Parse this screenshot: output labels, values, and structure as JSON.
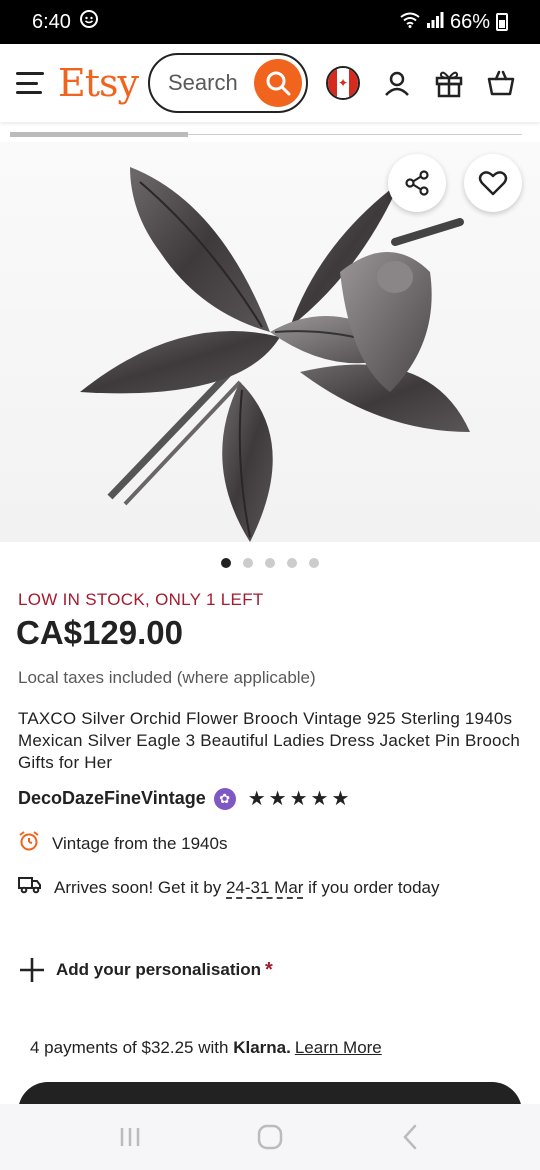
{
  "status_bar": {
    "time": "6:40",
    "battery": "66%"
  },
  "header": {
    "logo": "Etsy",
    "search_placeholder": "Search"
  },
  "carousel": {
    "total_images": 5,
    "active_index": 0
  },
  "product": {
    "stock_notice": "LOW IN STOCK, ONLY 1 LEFT",
    "price": "CA$129.00",
    "taxes_note": "Local taxes included (where applicable)",
    "title": "TAXCO Silver Orchid Flower Brooch Vintage 925 Sterling 1940s Mexican Silver Eagle 3 Beautiful Ladies Dress Jacket Pin Brooch Gifts for Her",
    "seller": "DecoDazeFineVintage",
    "rating": 5,
    "vintage_label": "Vintage from the 1940s",
    "arrives_prefix": "Arrives soon! Get it by ",
    "arrives_dates": "24-31 Mar",
    "arrives_suffix": " if you order today",
    "personalisation": "Add your personalisation",
    "personalisation_required": "*"
  },
  "klarna": {
    "prefix": "4 payments of $32.25 with ",
    "brand": "Klarna.",
    "learn_more": "Learn More"
  },
  "colors": {
    "brand_orange": "#f1641e",
    "stock_red": "#a61a2e",
    "star_seller_purple": "#7f58c6"
  }
}
